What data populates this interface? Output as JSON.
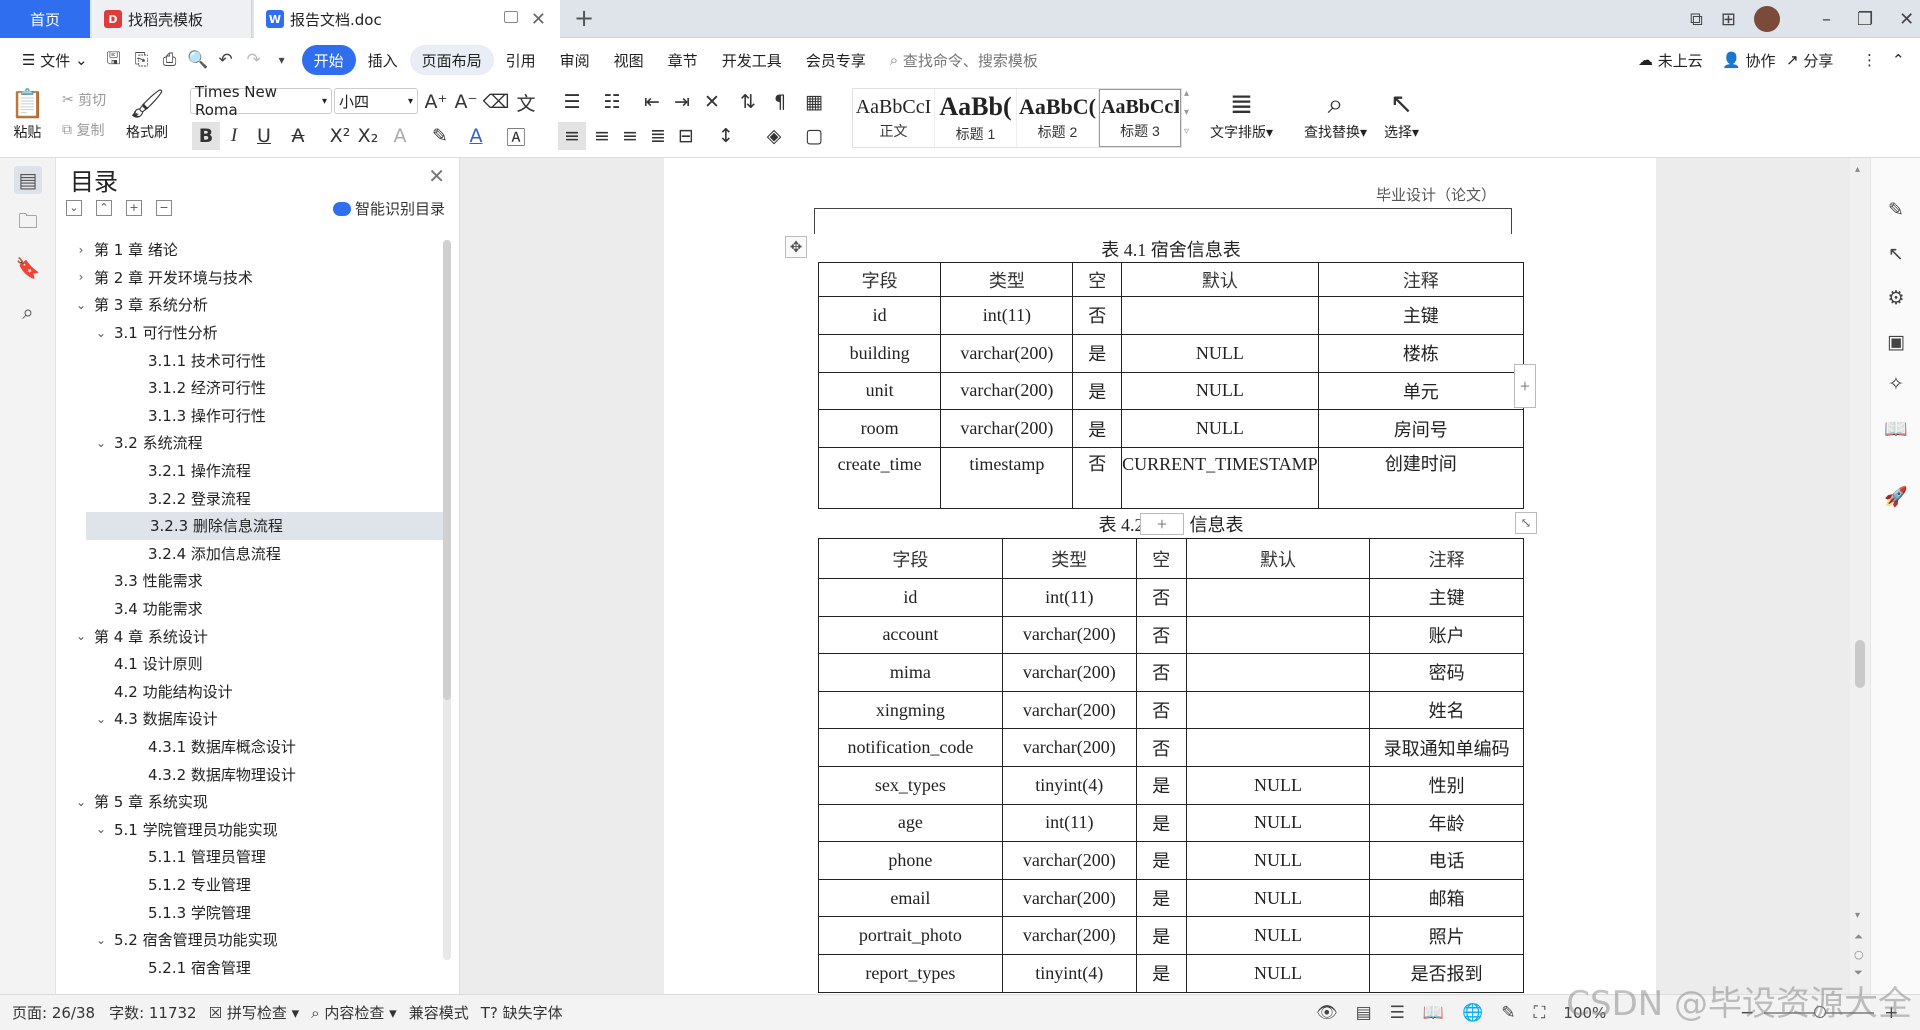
{
  "tabs": {
    "home": "首页",
    "t1": "找稻壳模板",
    "t2": "报告文档.doc"
  },
  "menu": {
    "file": "文件",
    "items": [
      "开始",
      "插入",
      "页面布局",
      "引用",
      "审阅",
      "视图",
      "章节",
      "开发工具",
      "会员专享"
    ],
    "search": "查找命令、搜索模板",
    "cloud": "未上云",
    "collab": "协作",
    "share": "分享"
  },
  "ribbon": {
    "paste": "粘贴",
    "cut": "剪切",
    "copy": "复制",
    "format_painter": "格式刷",
    "font_name": "Times New Roma",
    "font_size": "小四",
    "styles": [
      {
        "preview": "AaBbCcI",
        "name": "正文"
      },
      {
        "preview": "AaBb(",
        "name": "标题 1"
      },
      {
        "preview": "AaBbC(",
        "name": "标题 2"
      },
      {
        "preview": "AaBbCcI",
        "name": "标题 3"
      }
    ],
    "text_layout": "文字排版",
    "find_replace": "查找替换",
    "select": "选择"
  },
  "nav": {
    "title": "目录",
    "smart": "智能识别目录",
    "items": [
      {
        "label": "第 1 章  绪论",
        "level": 0,
        "arrow": "›"
      },
      {
        "label": "第 2 章  开发环境与技术",
        "level": 0,
        "arrow": "›"
      },
      {
        "label": "第 3 章  系统分析",
        "level": 0,
        "arrow": "⌄"
      },
      {
        "label": "3.1  可行性分析",
        "level": 1,
        "arrow": "⌄"
      },
      {
        "label": "3.1.1  技术可行性",
        "level": 2,
        "arrow": ""
      },
      {
        "label": "3.1.2  经济可行性",
        "level": 2,
        "arrow": ""
      },
      {
        "label": "3.1.3  操作可行性",
        "level": 2,
        "arrow": ""
      },
      {
        "label": "3.2  系统流程",
        "level": 1,
        "arrow": "⌄"
      },
      {
        "label": "3.2.1  操作流程",
        "level": 2,
        "arrow": ""
      },
      {
        "label": "3.2.2  登录流程",
        "level": 2,
        "arrow": ""
      },
      {
        "label": "3.2.3  删除信息流程",
        "level": 2,
        "arrow": "",
        "selected": true
      },
      {
        "label": "3.2.4  添加信息流程",
        "level": 2,
        "arrow": ""
      },
      {
        "label": "3.3  性能需求",
        "level": 1,
        "arrow": ""
      },
      {
        "label": "3.4  功能需求",
        "level": 1,
        "arrow": ""
      },
      {
        "label": "第 4 章  系统设计",
        "level": 0,
        "arrow": "⌄"
      },
      {
        "label": "4.1  设计原则",
        "level": 1,
        "arrow": ""
      },
      {
        "label": "4.2  功能结构设计",
        "level": 1,
        "arrow": ""
      },
      {
        "label": "4.3  数据库设计",
        "level": 1,
        "arrow": "⌄"
      },
      {
        "label": "4.3.1  数据库概念设计",
        "level": 2,
        "arrow": ""
      },
      {
        "label": "4.3.2  数据库物理设计",
        "level": 2,
        "arrow": ""
      },
      {
        "label": "第 5 章  系统实现",
        "level": 0,
        "arrow": "⌄"
      },
      {
        "label": "5.1  学院管理员功能实现",
        "level": 1,
        "arrow": "⌄"
      },
      {
        "label": "5.1.1  管理员管理",
        "level": 2,
        "arrow": ""
      },
      {
        "label": "5.1.2  专业管理",
        "level": 2,
        "arrow": ""
      },
      {
        "label": "5.1.3  学院管理",
        "level": 2,
        "arrow": ""
      },
      {
        "label": "5.2  宿舍管理员功能实现",
        "level": 1,
        "arrow": "⌄"
      },
      {
        "label": "5.2.1  宿舍管理",
        "level": 2,
        "arrow": ""
      }
    ]
  },
  "doc": {
    "header": "毕业设计（论文）",
    "table1": {
      "caption": "表 4.1  宿舍信息表",
      "headers": [
        "字段",
        "类型",
        "空",
        "默认",
        "注释"
      ],
      "rows": [
        [
          "id",
          "int(11)",
          "否",
          "",
          "主键"
        ],
        [
          "building",
          "varchar(200)",
          "是",
          "NULL",
          "楼栋"
        ],
        [
          "unit",
          "varchar(200)",
          "是",
          "NULL",
          "单元"
        ],
        [
          "room",
          "varchar(200)",
          "是",
          "NULL",
          "房间号"
        ],
        [
          "create_time",
          "timestamp",
          "否",
          "CURRENT_TIMESTAMP",
          "创建时间"
        ]
      ]
    },
    "table2": {
      "caption_left": "表 4.2",
      "caption_right": "信息表",
      "headers": [
        "字段",
        "类型",
        "空",
        "默认",
        "注释"
      ],
      "rows": [
        [
          "id",
          "int(11)",
          "否",
          "",
          "主键"
        ],
        [
          "account",
          "varchar(200)",
          "否",
          "",
          "账户"
        ],
        [
          "mima",
          "varchar(200)",
          "否",
          "",
          "密码"
        ],
        [
          "xingming",
          "varchar(200)",
          "否",
          "",
          "姓名"
        ],
        [
          "notification_code",
          "varchar(200)",
          "否",
          "",
          "录取通知单编码"
        ],
        [
          "sex_types",
          "tinyint(4)",
          "是",
          "NULL",
          "性别"
        ],
        [
          "age",
          "int(11)",
          "是",
          "NULL",
          "年龄"
        ],
        [
          "phone",
          "varchar(200)",
          "是",
          "NULL",
          "电话"
        ],
        [
          "email",
          "varchar(200)",
          "是",
          "NULL",
          "邮箱"
        ],
        [
          "portrait_photo",
          "varchar(200)",
          "是",
          "NULL",
          "照片"
        ],
        [
          "report_types",
          "tinyint(4)",
          "是",
          "NULL",
          "是否报到"
        ]
      ]
    }
  },
  "status": {
    "page": "页面: 26/38",
    "words": "字数: 11732",
    "spell": "拼写检查",
    "content_check": "内容检查",
    "compat": "兼容模式",
    "missing_font": "缺失字体",
    "zoom": "100%"
  },
  "watermark": "CSDN @毕设资源大全"
}
